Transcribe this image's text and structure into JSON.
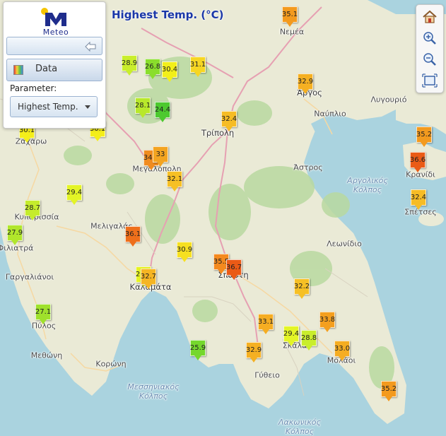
{
  "app": {
    "brand": "Meteo",
    "title": "Highest Temp. (°C)",
    "colors": {
      "brand_blue": "#1f2d8c",
      "brand_yellow": "#f5c400",
      "title_blue": "#1a37a8"
    }
  },
  "panel": {
    "data_button": "Data",
    "parameter_label": "Parameter:",
    "parameter_value": "Highest Temp.",
    "icons": [
      "back-arrow-icon",
      "data-palette-icon",
      "chevron-down-icon"
    ]
  },
  "tools": [
    "home-icon",
    "zoom-in-icon",
    "zoom-out-icon",
    "zoom-extent-icon"
  ],
  "places": [
    {
      "name": "Νεμέα"
    },
    {
      "name": "Άργος"
    },
    {
      "name": "Λυγουριό"
    },
    {
      "name": "Ναύπλιο"
    },
    {
      "name": "Ζαχάρω"
    },
    {
      "name": "Τρίπολη"
    },
    {
      "name": "Μεγαλόπολη"
    },
    {
      "name": "Άστρος"
    },
    {
      "name": "Αργολικός Κόλπος"
    },
    {
      "name": "Κρανίδι"
    },
    {
      "name": "Σπέτσες"
    },
    {
      "name": "Κυπαρισσία"
    },
    {
      "name": "Μελιγαλάς"
    },
    {
      "name": "Φιλιατρά"
    },
    {
      "name": "Λεωνίδιο"
    },
    {
      "name": "Γαργαλιάνοι"
    },
    {
      "name": "Σπάρτη"
    },
    {
      "name": "Καλαμάτα"
    },
    {
      "name": "Πύλος"
    },
    {
      "name": "Σκάλα"
    },
    {
      "name": "Μολάοι"
    },
    {
      "name": "Μεθώνη"
    },
    {
      "name": "Κορώνη"
    },
    {
      "name": "Γύθειο"
    },
    {
      "name": "Μεσσηνιακός Κόλπος"
    },
    {
      "name": "Λακωνικός Κόλπος"
    }
  ],
  "stations": [
    {
      "value": "35.1",
      "color": "#f39a1e"
    },
    {
      "value": "28.9",
      "color": "#c9ee2c"
    },
    {
      "value": "26.8",
      "color": "#8ade2c"
    },
    {
      "value": "30.4",
      "color": "#f2ef1a"
    },
    {
      "value": "31.1",
      "color": "#f6d623"
    },
    {
      "value": "32.9",
      "color": "#f5b022"
    },
    {
      "value": "28.1",
      "color": "#b8e82b"
    },
    {
      "value": "24.4",
      "color": "#4dc92f"
    },
    {
      "value": "32.4",
      "color": "#f6bc25"
    },
    {
      "value": "35.2",
      "color": "#f39a1e"
    },
    {
      "value": "30.1",
      "color": "#f4ee1a"
    },
    {
      "value": "30.1",
      "color": "#f4ee1a"
    },
    {
      "value": "34.7",
      "color": "#f08c20"
    },
    {
      "value": "33",
      "color": "#f3a421"
    },
    {
      "value": "32.1",
      "color": "#f6c025"
    },
    {
      "value": "36.6",
      "color": "#ea5b16"
    },
    {
      "value": "29.4",
      "color": "#e3f426"
    },
    {
      "value": "32.4",
      "color": "#f6bc25"
    },
    {
      "value": "28.7",
      "color": "#c5ec2c"
    },
    {
      "value": "27.9",
      "color": "#b1e62b"
    },
    {
      "value": "36.1",
      "color": "#ee6f1b"
    },
    {
      "value": "30.9",
      "color": "#f6e020"
    },
    {
      "value": "35.5",
      "color": "#f48a1e"
    },
    {
      "value": "36.7",
      "color": "#ea5a16"
    },
    {
      "value": "29.6",
      "color": "#e6f322"
    },
    {
      "value": "32.7",
      "color": "#f5b523"
    },
    {
      "value": "32.2",
      "color": "#f6c025"
    },
    {
      "value": "27.1",
      "color": "#9fe12c"
    },
    {
      "value": "33.1",
      "color": "#f5ad22"
    },
    {
      "value": "33.8",
      "color": "#f49f1f"
    },
    {
      "value": "29.4",
      "color": "#e3f426"
    },
    {
      "value": "28.8",
      "color": "#c9ee2c"
    },
    {
      "value": "33.0",
      "color": "#f5ad22"
    },
    {
      "value": "25.9",
      "color": "#75d72d"
    },
    {
      "value": "32.9",
      "color": "#f5b022"
    },
    {
      "value": "35.2",
      "color": "#f39a1e"
    }
  ]
}
